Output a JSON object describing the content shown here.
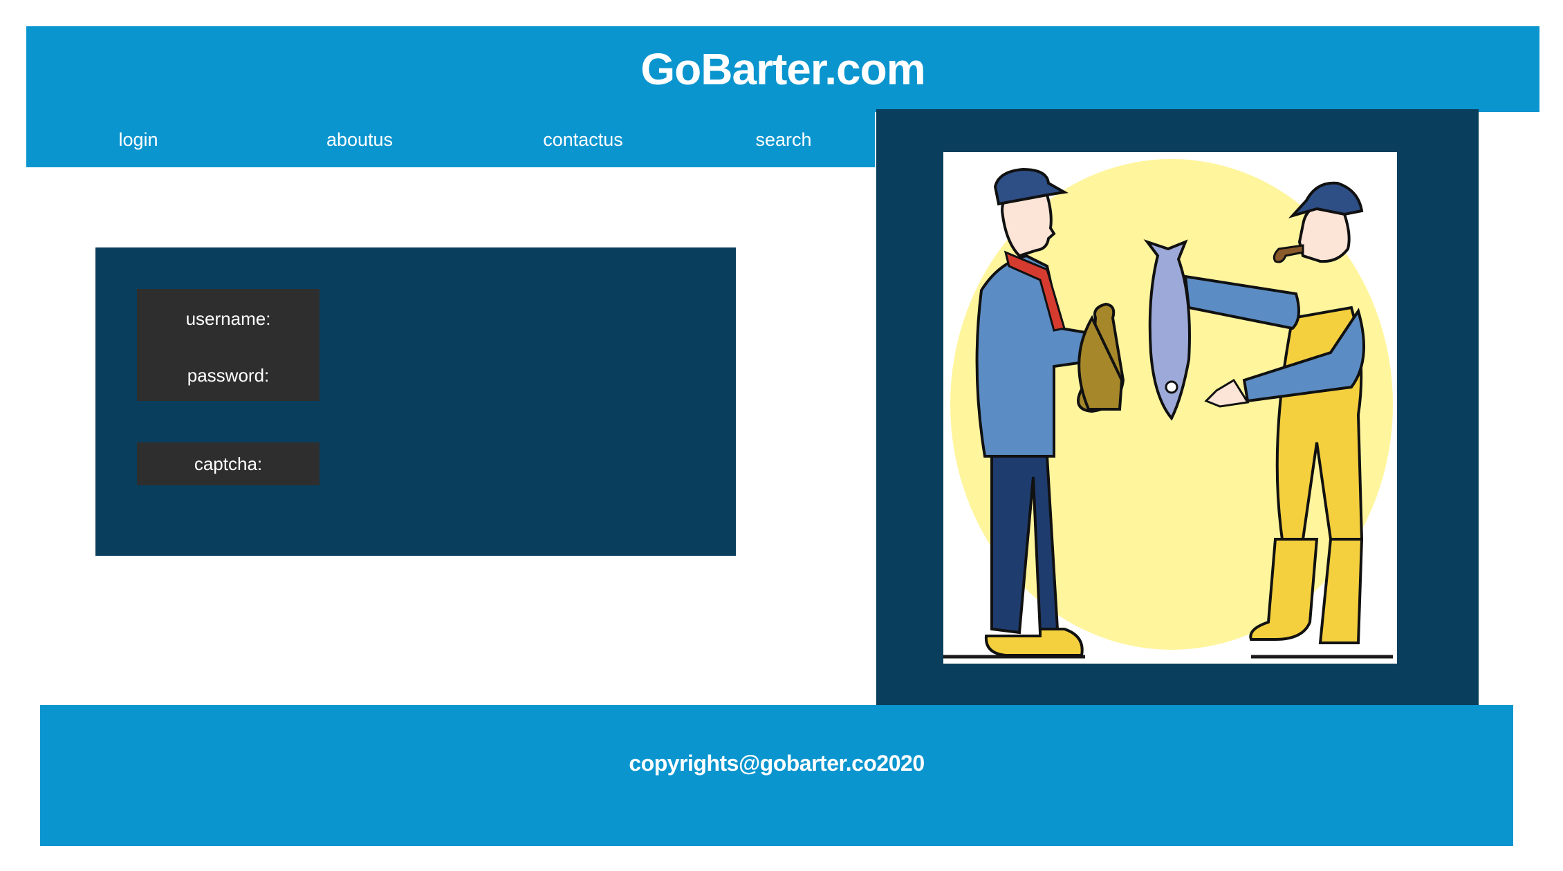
{
  "header": {
    "title": "GoBarter.com"
  },
  "nav": {
    "items": [
      {
        "label": "login"
      },
      {
        "label": "aboutus"
      },
      {
        "label": "contactus"
      },
      {
        "label": "search"
      }
    ]
  },
  "login_form": {
    "username_label": "username:",
    "password_label": "password:",
    "captcha_label": "captcha:"
  },
  "illustration": {
    "icon": "barter-fish-trade-illustration"
  },
  "footer": {
    "copyright": "copyrights@gobarter.co2020"
  },
  "colors": {
    "primary_blue": "#0A95CF",
    "dark_navy": "#0A3E5D",
    "label_box": "#2E2E2E",
    "text": "#FFFFFF"
  }
}
